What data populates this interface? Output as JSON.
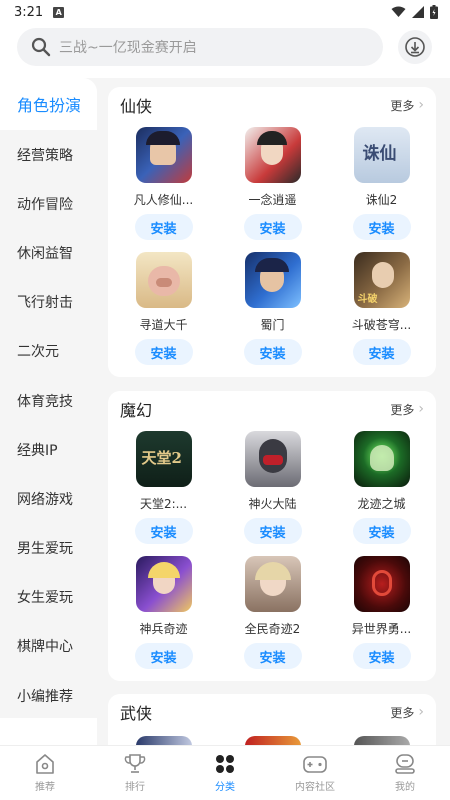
{
  "status": {
    "time": "3:21"
  },
  "search": {
    "placeholder": "三战~一亿现金赛开启"
  },
  "sidebar": {
    "items": [
      {
        "label": "角色扮演"
      },
      {
        "label": "经营策略"
      },
      {
        "label": "动作冒险"
      },
      {
        "label": "休闲益智"
      },
      {
        "label": "飞行射击"
      },
      {
        "label": "二次元"
      },
      {
        "label": "体育竞技"
      },
      {
        "label": "经典IP"
      },
      {
        "label": "网络游戏"
      },
      {
        "label": "男生爱玩"
      },
      {
        "label": "女生爱玩"
      },
      {
        "label": "棋牌中心"
      },
      {
        "label": "小编推荐"
      }
    ]
  },
  "sections": [
    {
      "title": "仙侠",
      "more": "更多",
      "games": [
        {
          "name": "凡人修仙...",
          "install": "安装",
          "icon": "fanren-icon"
        },
        {
          "name": "一念逍遥",
          "install": "安装",
          "icon": "yinian-icon"
        },
        {
          "name": "诛仙2",
          "install": "安装",
          "icon": "zhuxian-icon"
        },
        {
          "name": "寻道大千",
          "install": "安装",
          "icon": "xundao-icon"
        },
        {
          "name": "蜀门",
          "install": "安装",
          "icon": "shumen-icon"
        },
        {
          "name": "斗破苍穹...",
          "install": "安装",
          "icon": "doupo-icon"
        }
      ]
    },
    {
      "title": "魔幻",
      "more": "更多",
      "games": [
        {
          "name": "天堂2:...",
          "install": "安装",
          "icon": "tiantang-icon"
        },
        {
          "name": "神火大陆",
          "install": "安装",
          "icon": "shenhuo-icon"
        },
        {
          "name": "龙迹之城",
          "install": "安装",
          "icon": "longji-icon"
        },
        {
          "name": "神兵奇迹",
          "install": "安装",
          "icon": "shenbing-icon"
        },
        {
          "name": "全民奇迹2",
          "install": "安装",
          "icon": "quanmin-icon"
        },
        {
          "name": "异世界勇...",
          "install": "安装",
          "icon": "yishijie-icon"
        }
      ]
    },
    {
      "title": "武侠",
      "more": "更多"
    }
  ],
  "nav": [
    {
      "label": "推荐"
    },
    {
      "label": "排行"
    },
    {
      "label": "分类"
    },
    {
      "label": "内容社区"
    },
    {
      "label": "我的"
    }
  ],
  "colors": {
    "accent": "#1a8cff",
    "install_bg": "#eaf4ff",
    "sidebar_bg": "#f5f5f5"
  }
}
